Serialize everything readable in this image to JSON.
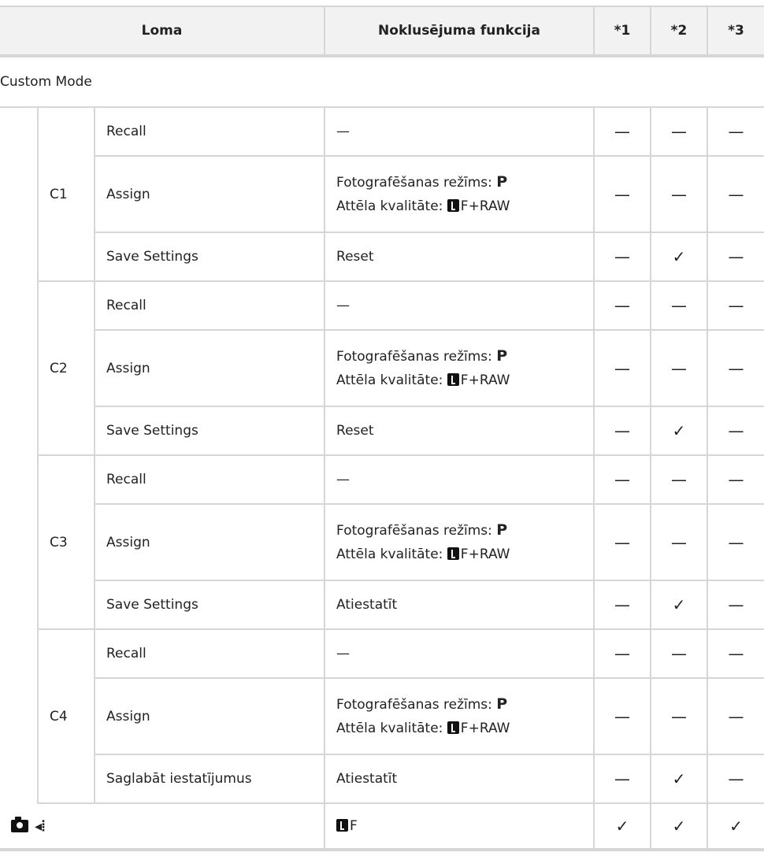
{
  "headers": {
    "role": "Loma",
    "default": "Noklusējuma funkcija",
    "c1": "*1",
    "c2": "*2",
    "c3": "*3"
  },
  "section": "Custom Mode",
  "groups": [
    {
      "label": "C1",
      "rows": [
        {
          "item": "Recall",
          "def1": "—",
          "def2": "",
          "m1": "—",
          "m2": "—",
          "m3": "—"
        },
        {
          "item": "Assign",
          "def1": "Fotografēšanas režīms:",
          "def1b": "P",
          "def2": "F+RAW",
          "def2a": "Attēla kvalitāte:",
          "m1": "—",
          "m2": "—",
          "m3": "—"
        },
        {
          "item": "Save Settings",
          "def1": "Reset",
          "m1": "—",
          "m2": "✓",
          "m3": "—"
        }
      ]
    },
    {
      "label": "C2",
      "rows": [
        {
          "item": "Recall",
          "def1": "—",
          "m1": "—",
          "m2": "—",
          "m3": "—"
        },
        {
          "item": "Assign",
          "def1": "Fotografēšanas režīms:",
          "def1b": "P",
          "def2a": "Attēla kvalitāte:",
          "def2": "F+RAW",
          "m1": "—",
          "m2": "—",
          "m3": "—"
        },
        {
          "item": "Save Settings",
          "def1": "Reset",
          "m1": "—",
          "m2": "✓",
          "m3": "—"
        }
      ]
    },
    {
      "label": "C3",
      "rows": [
        {
          "item": "Recall",
          "def1": "—",
          "m1": "—",
          "m2": "—",
          "m3": "—"
        },
        {
          "item": "Assign",
          "def1": "Fotografēšanas režīms:",
          "def1b": "P",
          "def2a": "Attēla kvalitāte:",
          "def2": "F+RAW",
          "m1": "—",
          "m2": "—",
          "m3": "—"
        },
        {
          "item": "Save Settings",
          "def1": "Atiestatīt",
          "m1": "—",
          "m2": "✓",
          "m3": "—"
        }
      ]
    },
    {
      "label": "C4",
      "rows": [
        {
          "item": "Recall",
          "def1": "—",
          "m1": "—",
          "m2": "—",
          "m3": "—"
        },
        {
          "item": "Assign",
          "def1": "Fotografēšanas režīms:",
          "def1b": "P",
          "def2a": "Attēla kvalitāte:",
          "def2": "F+RAW",
          "m1": "—",
          "m2": "—",
          "m3": "—"
        },
        {
          "item": "Saglabāt iestatījumus",
          "def1": "Atiestatīt",
          "m1": "—",
          "m2": "✓",
          "m3": "—"
        }
      ]
    }
  ],
  "last": {
    "default": "F",
    "m1": "✓",
    "m2": "✓",
    "m3": "✓",
    "role_icons": [
      "camera-icon",
      "drive-mode-icon"
    ]
  }
}
